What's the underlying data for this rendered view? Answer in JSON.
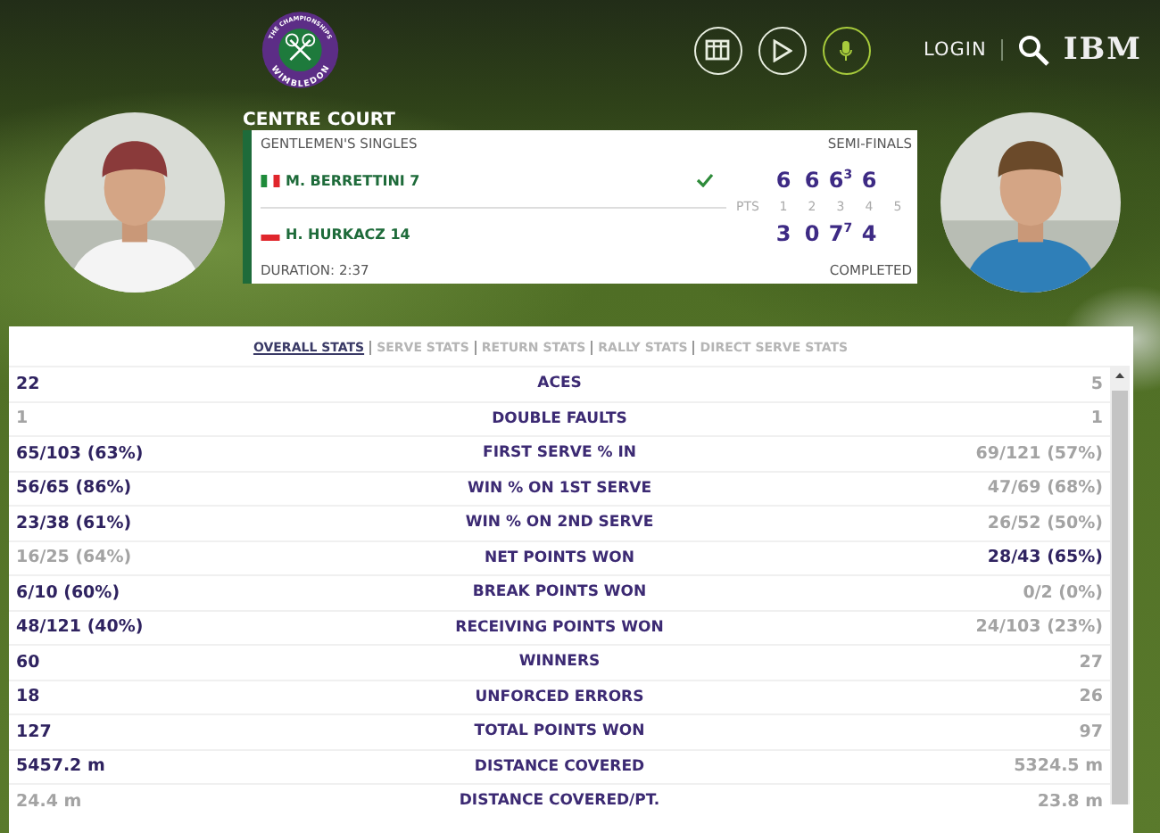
{
  "header": {
    "logo": {
      "top_text": "THE CHAMPIONSHIPS",
      "bottom_text": "WIMBLEDON"
    },
    "nav_buttons": [
      {
        "kind": "grid",
        "selected": false
      },
      {
        "kind": "play",
        "selected": false
      },
      {
        "kind": "mic",
        "selected": true
      }
    ],
    "login": "LOGIN",
    "sponsor": "IBM"
  },
  "match": {
    "court": "CENTRE COURT",
    "event": "GENTLEMEN'S SINGLES",
    "round": "SEMI-FINALS",
    "duration": "DURATION: 2:37",
    "status": "COMPLETED",
    "columns": [
      "PTS",
      "1",
      "2",
      "3",
      "4",
      "5"
    ],
    "players": [
      {
        "name": "M. BERRETTINI 7",
        "flag": {
          "kind": "italy"
        },
        "winner": true,
        "sets": [
          {
            "games": "6"
          },
          {
            "games": "6"
          },
          {
            "games": "6",
            "tiebreak": "3"
          },
          {
            "games": "6"
          }
        ]
      },
      {
        "name": "H. HURKACZ 14",
        "flag": {
          "kind": "poland"
        },
        "winner": false,
        "sets": [
          {
            "games": "3"
          },
          {
            "games": "0"
          },
          {
            "games": "7",
            "tiebreak": "7"
          },
          {
            "games": "4"
          }
        ]
      }
    ]
  },
  "stats": {
    "tabs": [
      {
        "label": "OVERALL STATS",
        "selected": true
      },
      {
        "label": "SERVE STATS",
        "selected": false
      },
      {
        "label": "RETURN STATS",
        "selected": false
      },
      {
        "label": "RALLY STATS",
        "selected": false
      },
      {
        "label": "DIRECT SERVE STATS",
        "selected": false
      }
    ],
    "rows": [
      {
        "label": "ACES",
        "left": {
          "value": "22",
          "highlighted": true
        },
        "right": {
          "value": "5",
          "highlighted": false
        }
      },
      {
        "label": "DOUBLE FAULTS",
        "left": {
          "value": "1",
          "highlighted": false
        },
        "right": {
          "value": "1",
          "highlighted": false
        }
      },
      {
        "label": "FIRST SERVE % IN",
        "left": {
          "value": "65/103 (63%)",
          "highlighted": true
        },
        "right": {
          "value": "69/121 (57%)",
          "highlighted": false
        }
      },
      {
        "label": "WIN % ON 1ST SERVE",
        "left": {
          "value": "56/65 (86%)",
          "highlighted": true
        },
        "right": {
          "value": "47/69 (68%)",
          "highlighted": false
        }
      },
      {
        "label": "WIN % ON 2ND SERVE",
        "left": {
          "value": "23/38 (61%)",
          "highlighted": true
        },
        "right": {
          "value": "26/52 (50%)",
          "highlighted": false
        }
      },
      {
        "label": "NET POINTS WON",
        "left": {
          "value": "16/25 (64%)",
          "highlighted": false
        },
        "right": {
          "value": "28/43 (65%)",
          "highlighted": true
        }
      },
      {
        "label": "BREAK POINTS WON",
        "left": {
          "value": "6/10 (60%)",
          "highlighted": true
        },
        "right": {
          "value": "0/2 (0%)",
          "highlighted": false
        }
      },
      {
        "label": "RECEIVING POINTS WON",
        "left": {
          "value": "48/121 (40%)",
          "highlighted": true
        },
        "right": {
          "value": "24/103 (23%)",
          "highlighted": false
        }
      },
      {
        "label": "WINNERS",
        "left": {
          "value": "60",
          "highlighted": true
        },
        "right": {
          "value": "27",
          "highlighted": false
        }
      },
      {
        "label": "UNFORCED ERRORS",
        "left": {
          "value": "18",
          "highlighted": true
        },
        "right": {
          "value": "26",
          "highlighted": false
        }
      },
      {
        "label": "TOTAL POINTS WON",
        "left": {
          "value": "127",
          "highlighted": true
        },
        "right": {
          "value": "97",
          "highlighted": false
        }
      },
      {
        "label": "DISTANCE COVERED",
        "left": {
          "value": "5457.2 m",
          "highlighted": true
        },
        "right": {
          "value": "5324.5 m",
          "highlighted": false
        }
      },
      {
        "label": "DISTANCE COVERED/PT.",
        "left": {
          "value": "24.4 m",
          "highlighted": false
        },
        "right": {
          "value": "23.8 m",
          "highlighted": false
        }
      }
    ]
  }
}
